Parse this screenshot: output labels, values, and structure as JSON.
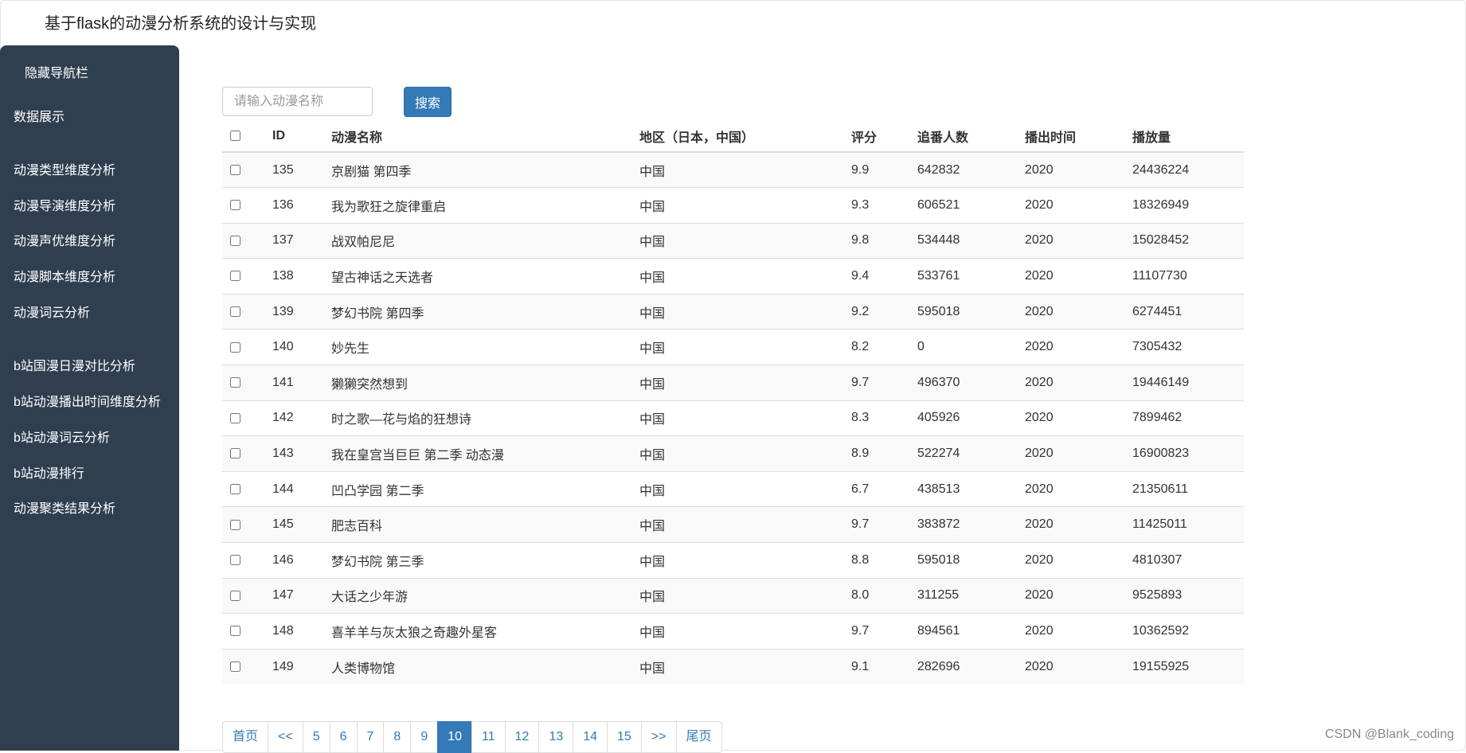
{
  "app": {
    "title": "基于flask的动漫分析系统的设计与实现"
  },
  "sidebar": {
    "hide_label": "隐藏导航栏",
    "items": [
      {
        "label": "数据展示"
      },
      {
        "label": "动漫类型维度分析"
      },
      {
        "label": "动漫导演维度分析"
      },
      {
        "label": "动漫声优维度分析"
      },
      {
        "label": "动漫脚本维度分析"
      },
      {
        "label": "动漫词云分析"
      },
      {
        "label": "b站国漫日漫对比分析"
      },
      {
        "label": "b站动漫播出时间维度分析"
      },
      {
        "label": "b站动漫词云分析"
      },
      {
        "label": "b站动漫排行"
      },
      {
        "label": "动漫聚类结果分析"
      }
    ]
  },
  "search": {
    "placeholder": "请输入动漫名称",
    "value": "",
    "button_label": "搜索"
  },
  "table": {
    "columns": [
      "ID",
      "动漫名称",
      "地区（日本，中国）",
      "评分",
      "追番人数",
      "播出时间",
      "播放量"
    ],
    "rows": [
      [
        "135",
        "京剧猫 第四季",
        "中国",
        "9.9",
        "642832",
        "2020",
        "24436224"
      ],
      [
        "136",
        "我为歌狂之旋律重启",
        "中国",
        "9.3",
        "606521",
        "2020",
        "18326949"
      ],
      [
        "137",
        "战双帕尼尼",
        "中国",
        "9.8",
        "534448",
        "2020",
        "15028452"
      ],
      [
        "138",
        "望古神话之天选者",
        "中国",
        "9.4",
        "533761",
        "2020",
        "11107730"
      ],
      [
        "139",
        "梦幻书院 第四季",
        "中国",
        "9.2",
        "595018",
        "2020",
        "6274451"
      ],
      [
        "140",
        "妙先生",
        "中国",
        "8.2",
        "0",
        "2020",
        "7305432"
      ],
      [
        "141",
        "獭獭突然想到",
        "中国",
        "9.7",
        "496370",
        "2020",
        "19446149"
      ],
      [
        "142",
        "时之歌—花与焰的狂想诗",
        "中国",
        "8.3",
        "405926",
        "2020",
        "7899462"
      ],
      [
        "143",
        "我在皇宫当巨巨 第二季 动态漫",
        "中国",
        "8.9",
        "522274",
        "2020",
        "16900823"
      ],
      [
        "144",
        "凹凸学园 第二季",
        "中国",
        "6.7",
        "438513",
        "2020",
        "21350611"
      ],
      [
        "145",
        "肥志百科",
        "中国",
        "9.7",
        "383872",
        "2020",
        "11425011"
      ],
      [
        "146",
        "梦幻书院 第三季",
        "中国",
        "8.8",
        "595018",
        "2020",
        "4810307"
      ],
      [
        "147",
        "大话之少年游",
        "中国",
        "8.0",
        "311255",
        "2020",
        "9525893"
      ],
      [
        "148",
        "喜羊羊与灰太狼之奇趣外星客",
        "中国",
        "9.7",
        "894561",
        "2020",
        "10362592"
      ],
      [
        "149",
        "人类博物馆",
        "中国",
        "9.1",
        "282696",
        "2020",
        "19155925"
      ]
    ]
  },
  "pagination": {
    "items": [
      "首页",
      "<<",
      "5",
      "6",
      "7",
      "8",
      "9",
      "10",
      "11",
      "12",
      "13",
      "14",
      "15",
      ">>",
      "尾页"
    ],
    "active": "10"
  },
  "watermark": {
    "text": "CSDN @Blank_coding"
  },
  "colors": {
    "sidebar_bg": "#2f3f50",
    "primary": "#337ab7",
    "stripe": "#f9f9f9"
  }
}
